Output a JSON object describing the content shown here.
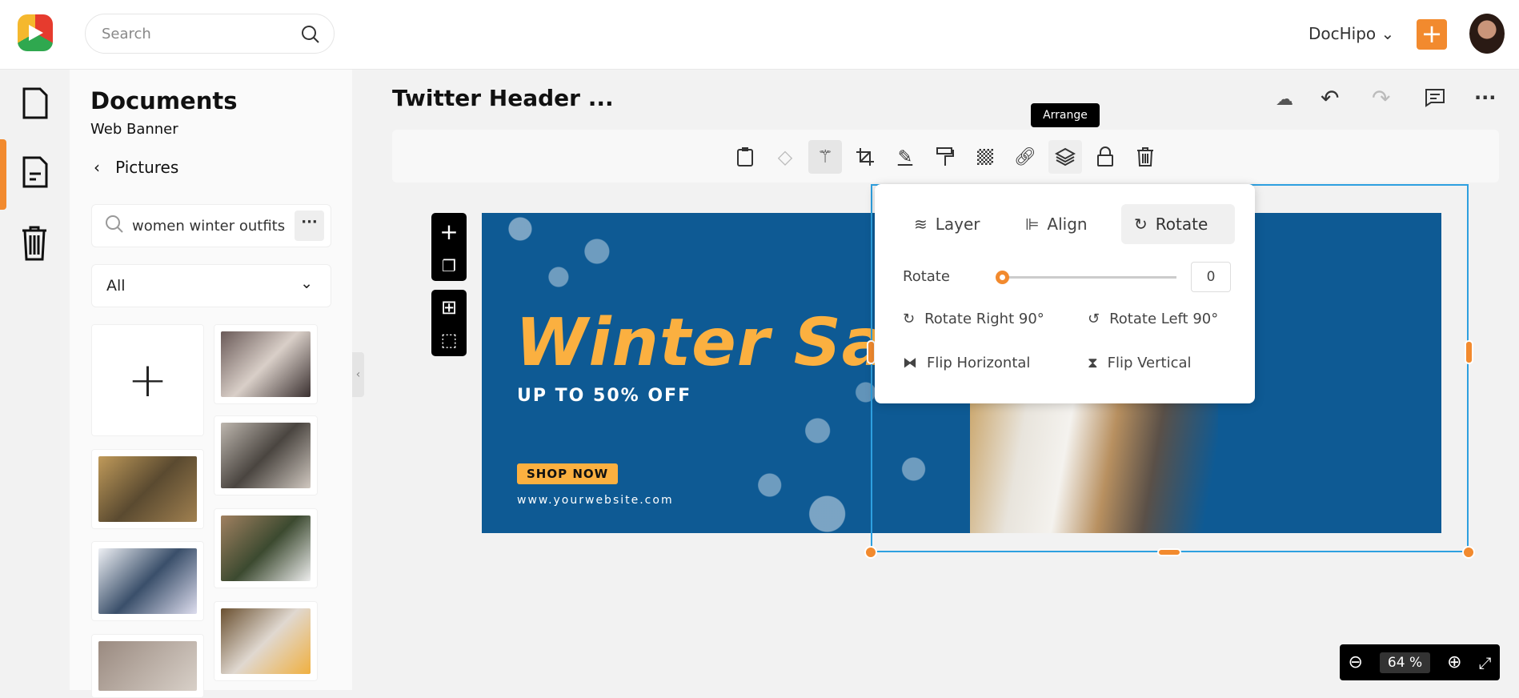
{
  "header": {
    "search_placeholder": "Search",
    "account": "DocHipo",
    "brand_color": "#f28a2e"
  },
  "panel": {
    "title": "Documents",
    "subtitle": "Web Banner",
    "back_label": "Pictures",
    "search_value": "women winter outfits",
    "filter": "All"
  },
  "editor": {
    "doc_title": "Twitter Header ...",
    "tooltip": "Arrange",
    "toolbar": [
      "clipboard-icon",
      "eraser-icon",
      "magic-wand-icon",
      "crop-icon",
      "pen-icon",
      "paint-roller-icon",
      "transparency-icon",
      "link-icon",
      "layers-icon",
      "lock-icon",
      "trash-icon"
    ]
  },
  "arrange": {
    "tabs": [
      "Layer",
      "Align",
      "Rotate"
    ],
    "active_tab": "Rotate",
    "rotate_label": "Rotate",
    "rotate_value": "0",
    "rotate_right": "Rotate Right 90°",
    "rotate_left": "Rotate Left 90°",
    "flip_h": "Flip Horizontal",
    "flip_v": "Flip Vertical"
  },
  "banner": {
    "headline": "Winter Sale",
    "offer": "UP TO 50% OFF",
    "cta": "SHOP NOW",
    "website": "www.yourwebsite.com",
    "bg": "#0e5a94",
    "accent": "#fbb040"
  },
  "zoom": {
    "value": "64",
    "unit": "%"
  }
}
